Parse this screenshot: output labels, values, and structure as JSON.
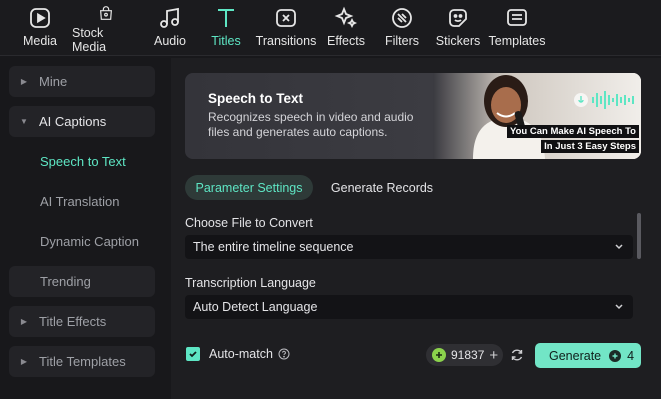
{
  "toolbar": {
    "items": [
      {
        "label": "Media",
        "icon": "media-icon"
      },
      {
        "label": "Stock Media",
        "icon": "stock-media-icon"
      },
      {
        "label": "Audio",
        "icon": "music-note-icon"
      },
      {
        "label": "Titles",
        "icon": "text-t-icon"
      },
      {
        "label": "Transitions",
        "icon": "transitions-icon"
      },
      {
        "label": "Effects",
        "icon": "effects-sparkle-icon"
      },
      {
        "label": "Filters",
        "icon": "filters-icon"
      },
      {
        "label": "Stickers",
        "icon": "sticker-icon"
      },
      {
        "label": "Templates",
        "icon": "templates-icon"
      }
    ],
    "active": "Titles"
  },
  "sidebar": {
    "items": [
      {
        "label": "Mine",
        "type": "collapsed"
      },
      {
        "label": "AI Captions",
        "type": "expanded"
      },
      {
        "label": "Speech to Text",
        "type": "sub-active"
      },
      {
        "label": "AI Translation",
        "type": "sub"
      },
      {
        "label": "Dynamic Caption",
        "type": "sub"
      },
      {
        "label": "Trending",
        "type": "plain"
      },
      {
        "label": "Title Effects",
        "type": "collapsed"
      },
      {
        "label": "Title Templates",
        "type": "collapsed"
      }
    ]
  },
  "banner": {
    "title": "Speech to Text",
    "description": "Recognizes speech in video and audio files and generates auto captions.",
    "caption_line1": "You Can Make AI Speech To",
    "caption_line2": "In Just  3 Easy Steps"
  },
  "tabs": {
    "parameter_settings": "Parameter Settings",
    "generate_records": "Generate Records"
  },
  "form": {
    "file_label": "Choose File to Convert",
    "file_value": "The entire timeline sequence",
    "language_label": "Transcription Language",
    "language_value": "Auto Detect Language",
    "automatch_label": "Auto-match",
    "automatch_checked": true
  },
  "footer": {
    "credits": "91837",
    "generate_label": "Generate",
    "generate_cost": "4"
  },
  "colors": {
    "accent": "#5ee6c4",
    "generate_bg": "#72e5c6",
    "coin": "#8bd24c"
  }
}
